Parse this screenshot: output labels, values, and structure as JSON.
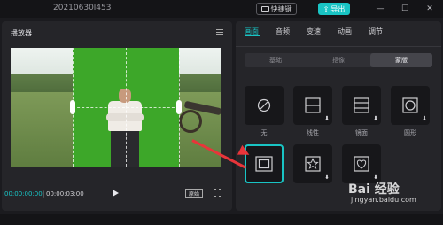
{
  "window": {
    "project_name": "20210630l453",
    "shortcut_label": "快捷键",
    "export_label": "导出",
    "controls": [
      "—",
      "☐",
      "✕"
    ]
  },
  "player": {
    "title": "播放器",
    "time_current": "00:00:00:00",
    "time_total": "00:00:03:00",
    "ratio_label": "原始"
  },
  "properties": {
    "tabs": [
      {
        "label": "画面",
        "active": true
      },
      {
        "label": "音频",
        "active": false
      },
      {
        "label": "变速",
        "active": false
      },
      {
        "label": "动画",
        "active": false
      },
      {
        "label": "调节",
        "active": false
      }
    ],
    "subtabs": [
      {
        "label": "基础",
        "active": false
      },
      {
        "label": "抠像",
        "active": false
      },
      {
        "label": "蒙版",
        "active": true
      }
    ],
    "masks": [
      {
        "label": "无",
        "icon": "no-mask-icon",
        "download": false,
        "selected": false
      },
      {
        "label": "线性",
        "icon": "linear-mask-icon",
        "download": true,
        "selected": false
      },
      {
        "label": "镜面",
        "icon": "mirror-mask-icon",
        "download": true,
        "selected": false
      },
      {
        "label": "圆形",
        "icon": "circle-mask-icon",
        "download": true,
        "selected": false
      },
      {
        "label": "",
        "icon": "rectangle-mask-icon",
        "download": false,
        "selected": true
      },
      {
        "label": "",
        "icon": "star-mask-icon",
        "download": true,
        "selected": false
      },
      {
        "label": "",
        "icon": "heart-mask-icon",
        "download": true,
        "selected": false
      }
    ]
  },
  "watermark": {
    "brand": "Bai 经验",
    "url": "jingyan.baidu.com"
  }
}
